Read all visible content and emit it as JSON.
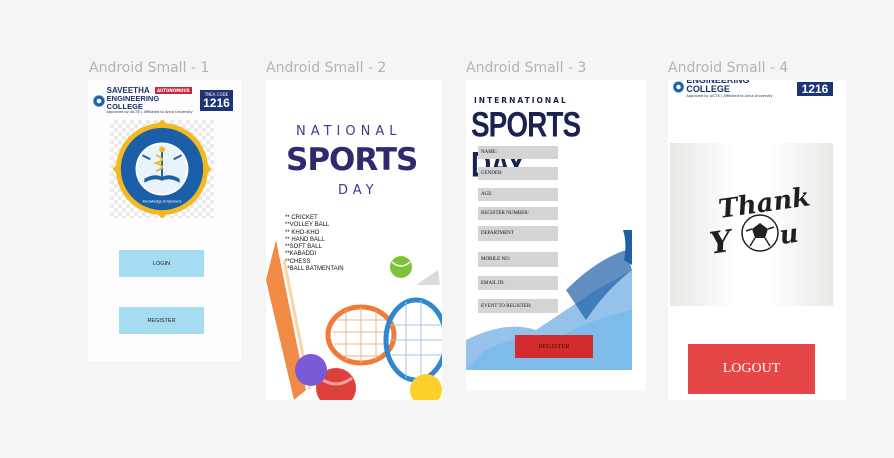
{
  "frames": [
    {
      "label": "Android Small - 1"
    },
    {
      "label": "Android Small - 2"
    },
    {
      "label": "Android Small - 3"
    },
    {
      "label": "Android Small - 4"
    }
  ],
  "college": {
    "name_line1": "SAVEETHA",
    "name_line2": "ENGINEERING COLLEGE",
    "autonomous": "AUTONOMOUS",
    "approved": "Approved by AICTE | Affiliated to Anna University",
    "tnea_label": "TNEA CODE",
    "tnea_code": "1216"
  },
  "institute_logo": {
    "ring_text": "SAVEETHA INSTITUTE OF MEDICAL AND TECHNICAL SCIENCES",
    "motto": "Knowledge Empowers",
    "colors": {
      "ring": "#1b5fa8",
      "gear": "#f3b91f"
    }
  },
  "frame1": {
    "login_label": "LOGIN",
    "register_label": "REGISTER",
    "button_color": "#a6dcf2"
  },
  "frame2": {
    "title_top": "NATIONAL",
    "title_main": "SPORTS",
    "title_bottom": "DAY",
    "sports": [
      "** CRICKET",
      "**VOLLEY BALL",
      "** KHO-KHO",
      "** HAND BALL",
      "**SOFT BALL",
      "**KABADDI",
      "**CHESS",
      "**BALL BATMENTAIN"
    ]
  },
  "frame3": {
    "title_top": "INTERNATIONAL",
    "title_main": "SPORTS DAY",
    "fields": [
      "NAME:",
      "GENDER:",
      "AGE:",
      "REGISTER NUMBER:",
      "DEPARTMENT",
      "MOBILE NO:",
      "EMAIL ID:",
      "EVENT TO REGISTER:"
    ],
    "register_label": "REGISTER",
    "accent": "#d42c2c"
  },
  "frame4": {
    "thank_line1": "Thank",
    "thank_line2_a": "Y",
    "thank_line2_b": "u",
    "logout_label": "LOGOUT",
    "logout_color": "#e54748"
  }
}
